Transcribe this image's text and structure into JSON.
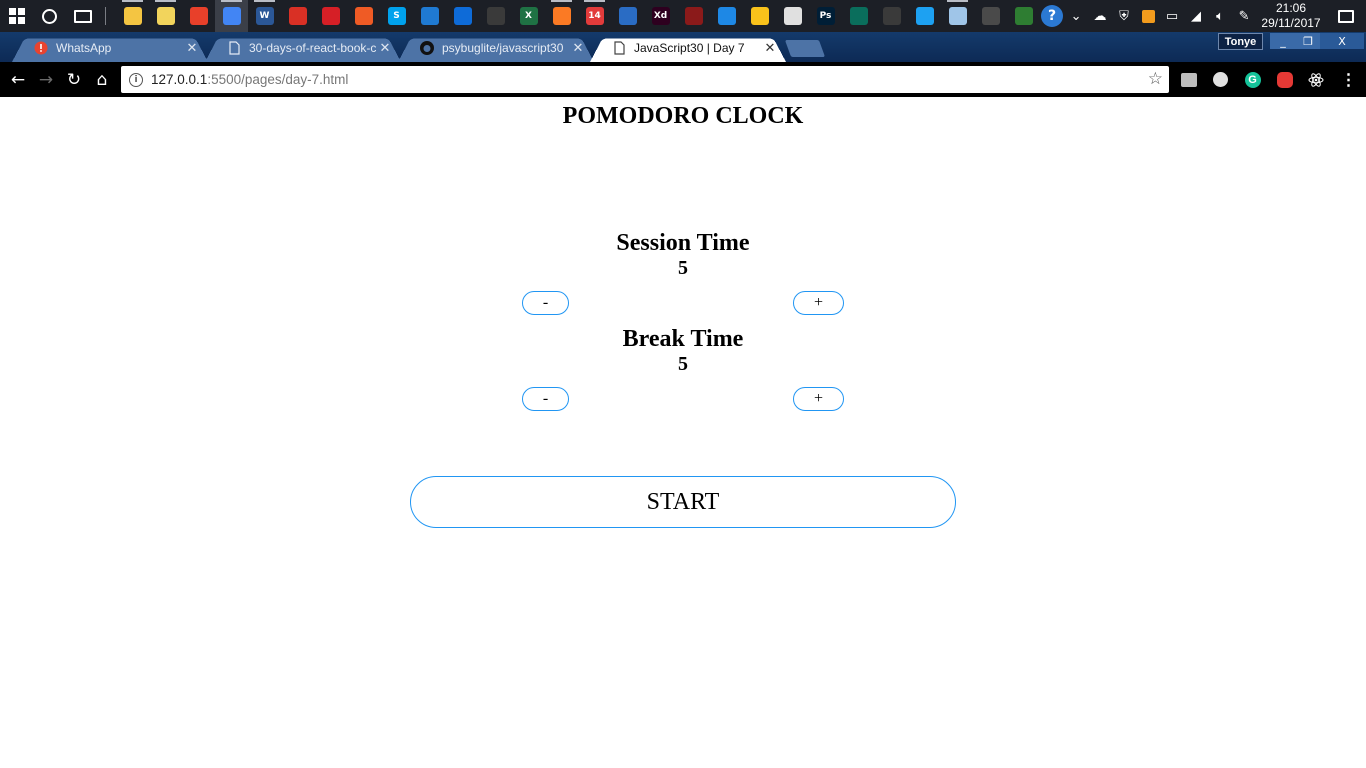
{
  "taskbar": {
    "clock_time": "21:06",
    "clock_date": "29/11/2017",
    "apps": [
      {
        "name": "file-explorer",
        "color": "#f4c542",
        "label": ""
      },
      {
        "name": "sticky-notes",
        "color": "#f2d45c",
        "label": ""
      },
      {
        "name": "brave",
        "color": "#e8402a",
        "label": ""
      },
      {
        "name": "chrome",
        "color": "#4285f4",
        "label": ""
      },
      {
        "name": "word",
        "color": "#2b5797",
        "label": "W"
      },
      {
        "name": "acrobat",
        "color": "#d93025",
        "label": ""
      },
      {
        "name": "opera",
        "color": "#d61f26",
        "label": ""
      },
      {
        "name": "postman",
        "color": "#ef5b25",
        "label": ""
      },
      {
        "name": "skype",
        "color": "#00a2ed",
        "label": "S"
      },
      {
        "name": "vscode",
        "color": "#1f7ad2",
        "label": ""
      },
      {
        "name": "teamviewer",
        "color": "#0e6bd8",
        "label": ""
      },
      {
        "name": "cmd",
        "color": "#3a3a3a",
        "label": ""
      },
      {
        "name": "excel",
        "color": "#1f7244",
        "label": "X"
      },
      {
        "name": "xampp",
        "color": "#fb7a24",
        "label": ""
      },
      {
        "name": "fourteen",
        "color": "#e23b3b",
        "label": "14"
      },
      {
        "name": "app-blue",
        "color": "#2a6cc4",
        "label": ""
      },
      {
        "name": "adobe-xd",
        "color": "#2e001f",
        "label": "Xd"
      },
      {
        "name": "app-red",
        "color": "#8b1a1a",
        "label": ""
      },
      {
        "name": "app-cyan",
        "color": "#1e88e5",
        "label": ""
      },
      {
        "name": "app-yellow",
        "color": "#f9c21b",
        "label": ""
      },
      {
        "name": "app-circle",
        "color": "#e0e0e0",
        "label": ""
      },
      {
        "name": "photoshop",
        "color": "#001e36",
        "label": "Ps"
      },
      {
        "name": "app-teal",
        "color": "#0a6e5c",
        "label": ""
      },
      {
        "name": "app-glyph",
        "color": "#3a3a3a",
        "label": ""
      },
      {
        "name": "twitter",
        "color": "#1da1f2",
        "label": ""
      },
      {
        "name": "notepad",
        "color": "#9fc5e8",
        "label": ""
      },
      {
        "name": "calculator",
        "color": "#4a4a4a",
        "label": ""
      },
      {
        "name": "git",
        "color": "#2e7d32",
        "label": ""
      }
    ]
  },
  "tabs": [
    {
      "title": "WhatsApp",
      "favicon": "whatsapp-alert-icon",
      "active": false
    },
    {
      "title": "30-days-of-react-book-c",
      "favicon": "page-icon",
      "active": false
    },
    {
      "title": "psybuglite/javascript30",
      "favicon": "github-icon",
      "active": false
    },
    {
      "title": "JavaScript30 | Day 7",
      "favicon": "page-icon",
      "active": true
    }
  ],
  "profile": "Tonye",
  "window_controls": {
    "minimize": "_",
    "maximize": "❐",
    "close": "X"
  },
  "address_bar": {
    "host": "127.0.0.1",
    "path": ":5500/pages/day-7.html"
  },
  "page": {
    "title": "POMODORO CLOCK",
    "session": {
      "label": "Session Time",
      "value": "5",
      "minus": "-",
      "plus": "+"
    },
    "break": {
      "label": "Break Time",
      "value": "5",
      "minus": "-",
      "plus": "+"
    },
    "start_label": "START"
  },
  "colors": {
    "button_border": "#2196f3",
    "tabstrip": "#143a6b",
    "toolbar": "#000000",
    "taskbar": "#1c1f26"
  }
}
